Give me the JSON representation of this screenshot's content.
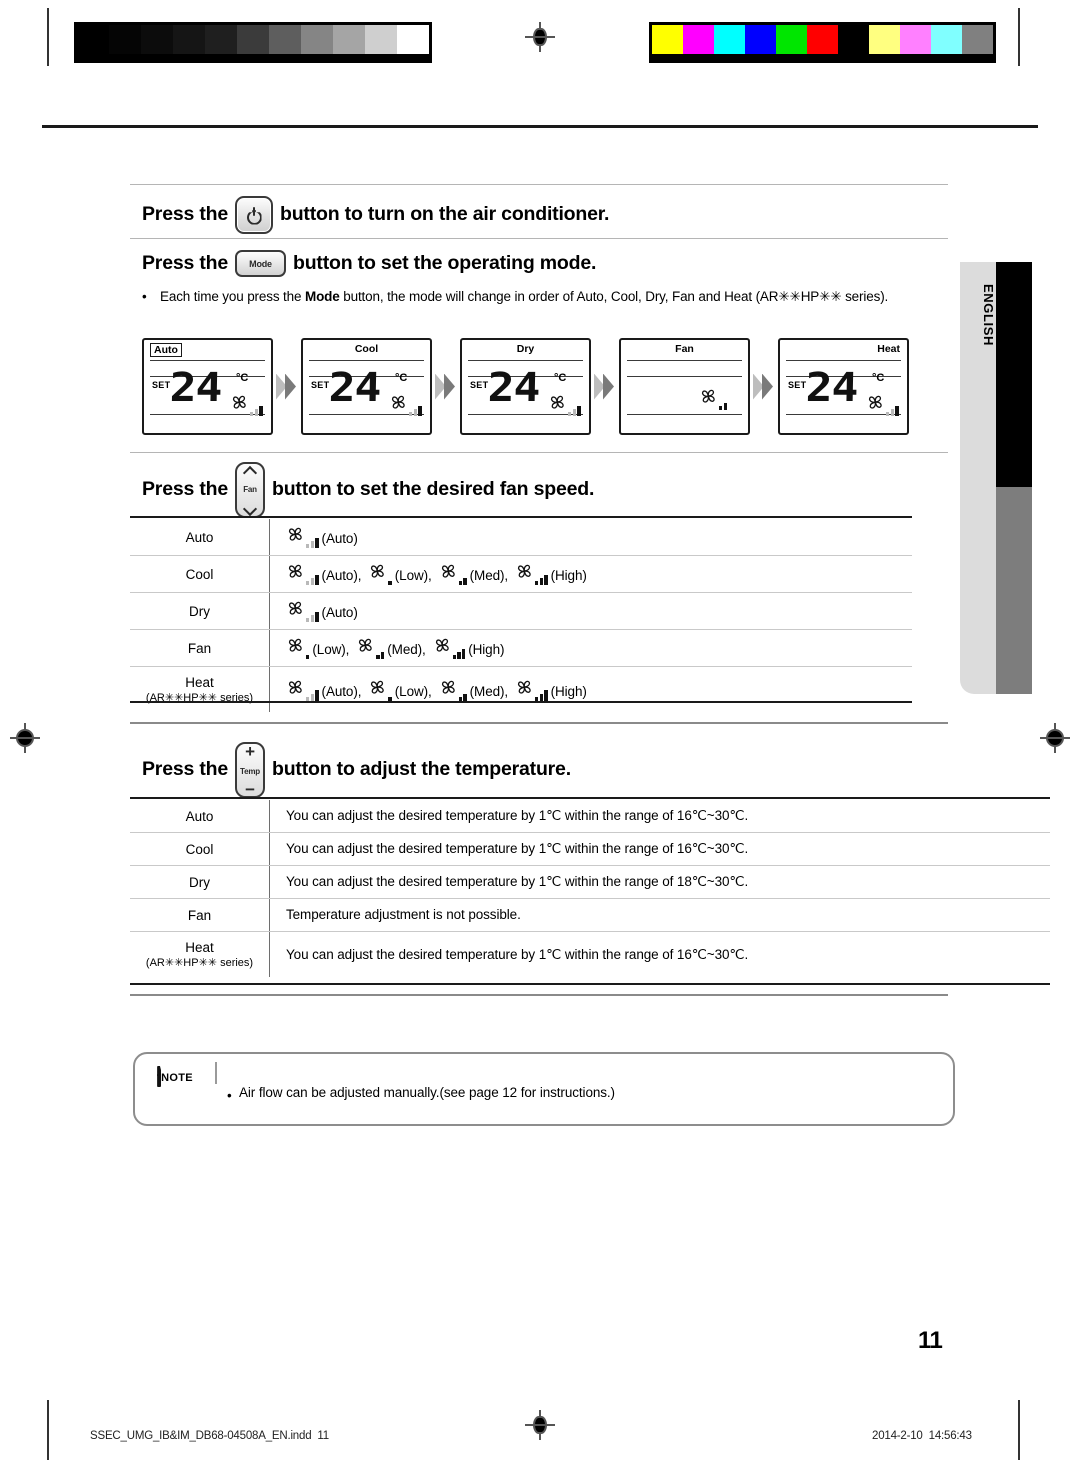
{
  "calibration": {
    "gray_swatches": [
      "#000000",
      "#050505",
      "#0c0c0c",
      "#151515",
      "#1f1f1f",
      "#3b3b3b",
      "#5e5e5e",
      "#858585",
      "#a5a5a5",
      "#cfcfcf",
      "#ffffff"
    ],
    "color_swatches": [
      "#ffff00",
      "#ff00ff",
      "#00ffff",
      "#0000ff",
      "#00e600",
      "#ff0000",
      "#000000",
      "#ffff80",
      "#ff80ff",
      "#80ffff",
      "#808080"
    ]
  },
  "sections": {
    "power": {
      "prefix": "Press the",
      "button": {
        "name": "power-button",
        "label": ""
      },
      "suffix": "button to turn on the air conditioner."
    },
    "mode": {
      "prefix": "Press the",
      "button": {
        "name": "mode-button",
        "label": "Mode"
      },
      "suffix": "button to set the operating mode.",
      "bullet_dot": "•",
      "bullet_before": "Each time you press the ",
      "bullet_bold": "Mode",
      "bullet_after": " button, the mode will change in order of Auto, Cool, Dry, Fan and Heat (AR✳✳HP✳✳ series)."
    },
    "fan": {
      "prefix": "Press the",
      "button": {
        "name": "fan-button",
        "label": "Fan",
        "up": "chevron-up",
        "down": "chevron-down"
      },
      "suffix": "button to set the desired fan speed."
    },
    "temp": {
      "prefix": "Press the",
      "button": {
        "name": "temp-button",
        "label": "Temp",
        "plus": "+",
        "minus": "−"
      },
      "suffix": "button to adjust the temperature."
    }
  },
  "lcd_panels": [
    {
      "mode": "Auto",
      "boxed": true,
      "align": "left",
      "set": "SET",
      "value": "24",
      "unit": "°C",
      "show_temp": true,
      "fan": "auto"
    },
    {
      "mode": "Cool",
      "boxed": false,
      "align": "center",
      "set": "SET",
      "value": "24",
      "unit": "°C",
      "show_temp": true,
      "fan": "auto"
    },
    {
      "mode": "Dry",
      "boxed": false,
      "align": "center",
      "set": "SET",
      "value": "24",
      "unit": "°C",
      "show_temp": true,
      "fan": "auto"
    },
    {
      "mode": "Fan",
      "boxed": false,
      "align": "center",
      "set": "",
      "value": "",
      "unit": "",
      "show_temp": false,
      "fan": "med"
    },
    {
      "mode": "Heat",
      "boxed": false,
      "align": "right",
      "set": "SET",
      "value": "24",
      "unit": "°C",
      "show_temp": true,
      "fan": "auto"
    }
  ],
  "fan_table": {
    "rows": [
      {
        "mode": "Auto",
        "sub": "",
        "speeds": [
          {
            "bars": "auto",
            "label": "(Auto)"
          }
        ]
      },
      {
        "mode": "Cool",
        "sub": "",
        "speeds": [
          {
            "bars": "auto",
            "label": "(Auto),"
          },
          {
            "bars": "low",
            "label": "(Low),"
          },
          {
            "bars": "med",
            "label": "(Med),"
          },
          {
            "bars": "high",
            "label": "(High)"
          }
        ]
      },
      {
        "mode": "Dry",
        "sub": "",
        "speeds": [
          {
            "bars": "auto",
            "label": "(Auto)"
          }
        ]
      },
      {
        "mode": "Fan",
        "sub": "",
        "speeds": [
          {
            "bars": "low",
            "label": "(Low),"
          },
          {
            "bars": "med",
            "label": "(Med),"
          },
          {
            "bars": "high",
            "label": "(High)"
          }
        ]
      },
      {
        "mode": "Heat",
        "sub": "(AR✳✳HP✳✳ series)",
        "speeds": [
          {
            "bars": "auto",
            "label": "(Auto),"
          },
          {
            "bars": "low",
            "label": "(Low),"
          },
          {
            "bars": "med",
            "label": "(Med),"
          },
          {
            "bars": "high",
            "label": "(High)"
          }
        ]
      }
    ]
  },
  "temp_table": {
    "rows": [
      {
        "mode": "Auto",
        "sub": "",
        "text": "You can adjust the desired temperature by 1℃ within the range of 16℃~30℃."
      },
      {
        "mode": "Cool",
        "sub": "",
        "text": "You can adjust the desired temperature by 1℃ within the range of 16℃~30℃."
      },
      {
        "mode": "Dry",
        "sub": "",
        "text": "You can adjust the desired temperature by 1℃ within the range of 18℃~30℃."
      },
      {
        "mode": "Fan",
        "sub": "",
        "text": "Temperature adjustment is not possible."
      },
      {
        "mode": "Heat",
        "sub": "(AR✳✳HP✳✳ series)",
        "text": "You can adjust the desired temperature by 1℃ within the range of 16℃~30℃."
      }
    ]
  },
  "note": {
    "icon_caption": "NOTE",
    "bullet": "•",
    "text": "Air flow can be adjusted manually.(see page 12 for instructions.)"
  },
  "side_tab": {
    "language": "ENGLISH"
  },
  "footer": {
    "page_number": "11",
    "file_name": "SSEC_UMG_IB&IM_DB68-04508A_EN.indd",
    "file_page": "11",
    "date": "2014-2-10",
    "time": "14:56:43"
  }
}
